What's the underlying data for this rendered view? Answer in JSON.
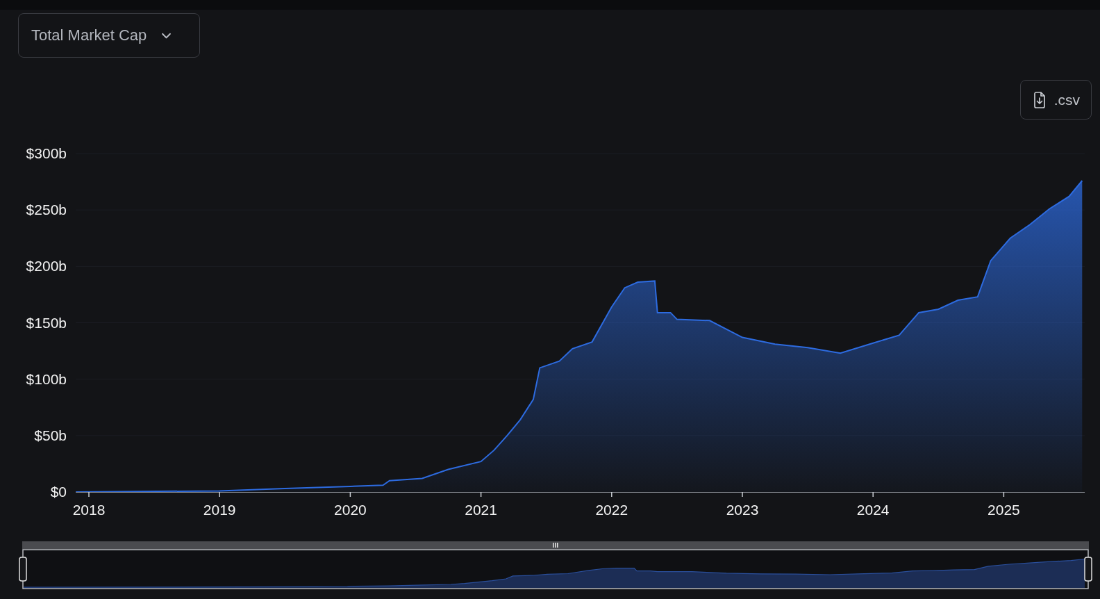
{
  "metric_select": {
    "label": "Total Market Cap",
    "expanded": false
  },
  "csv_button": {
    "label": ".csv"
  },
  "chart": {
    "chart_data": {
      "type": "area",
      "x": [
        2017.9,
        2019.0,
        2019.5,
        2020.0,
        2020.25,
        2020.3,
        2020.55,
        2020.75,
        2021.0,
        2021.1,
        2021.2,
        2021.3,
        2021.4,
        2021.45,
        2021.6,
        2021.7,
        2021.85,
        2022.0,
        2022.1,
        2022.2,
        2022.33,
        2022.35,
        2022.45,
        2022.5,
        2022.75,
        2023.0,
        2023.25,
        2023.5,
        2023.75,
        2024.0,
        2024.2,
        2024.35,
        2024.5,
        2024.65,
        2024.8,
        2024.9,
        2025.05,
        2025.2,
        2025.35,
        2025.5,
        2025.6
      ],
      "grid": true,
      "series": [
        {
          "color": "#2d6be0",
          "values": [
            0,
            1,
            3,
            5,
            6,
            10,
            12,
            20,
            27,
            37,
            50,
            64,
            82,
            110,
            116,
            127,
            133,
            164,
            181,
            186,
            187,
            159,
            159,
            153,
            152,
            137,
            131,
            128,
            123,
            132,
            139,
            159,
            162,
            170,
            173,
            205,
            225,
            237,
            251,
            262,
            276
          ]
        }
      ],
      "xlim": [
        2017.9,
        2025.62
      ],
      "ylim": [
        0,
        300
      ],
      "xticks": [
        {
          "value": 2018,
          "label": "2018"
        },
        {
          "value": 2019,
          "label": "2019"
        },
        {
          "value": 2020,
          "label": "2020"
        },
        {
          "value": 2021,
          "label": "2021"
        },
        {
          "value": 2022,
          "label": "2022"
        },
        {
          "value": 2023,
          "label": "2023"
        },
        {
          "value": 2024,
          "label": "2024"
        },
        {
          "value": 2025,
          "label": "2025"
        }
      ],
      "yticks": [
        {
          "value": 0,
          "label": "$0"
        },
        {
          "value": 50,
          "label": "$50b"
        },
        {
          "value": 100,
          "label": "$100b"
        },
        {
          "value": 150,
          "label": "$150b"
        },
        {
          "value": 200,
          "label": "$200b"
        },
        {
          "value": 250,
          "label": "$250b"
        },
        {
          "value": 300,
          "label": "$300b"
        }
      ]
    }
  }
}
